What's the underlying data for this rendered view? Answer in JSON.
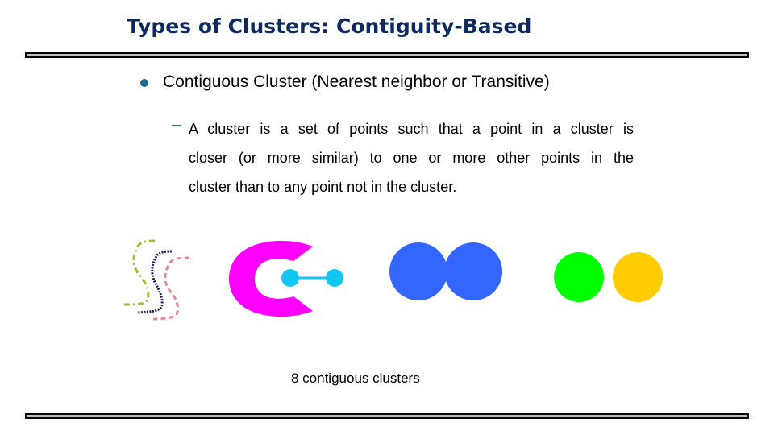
{
  "slide": {
    "title": "Types of Clusters: Contiguity-Based",
    "bullet": {
      "text": "Contiguous Cluster (Nearest neighbor or Transitive)",
      "sub_bullet": {
        "lines": [
          "A cluster is a set of points such that a point in a cluster is",
          "closer (or more similar) to one or more other points in the",
          "cluster than to any point not in the cluster."
        ]
      }
    },
    "figure": {
      "caption": "8 contiguous clusters",
      "clusters": [
        {
          "name": "green-dash-dot-s-curve",
          "shape": "s-curve",
          "style": "dash-dot",
          "color": "#9dc02c"
        },
        {
          "name": "navy-dotted-s-curve",
          "shape": "s-curve",
          "style": "dotted",
          "color": "#1b1f5e"
        },
        {
          "name": "pink-dashed-s-curve",
          "shape": "s-curve",
          "style": "dashed",
          "color": "#e08a9a"
        },
        {
          "name": "magenta-c-shape",
          "shape": "c-shape",
          "color": "#ff00ff"
        },
        {
          "name": "cyan-dumbbell",
          "shape": "two-points-with-link",
          "color": "#12c6f2"
        },
        {
          "name": "blue-touching-circles",
          "shape": "two-overlapping-circles",
          "color": "#3366ff"
        },
        {
          "name": "green-circle",
          "shape": "circle",
          "color": "#00ff00"
        },
        {
          "name": "yellow-circle",
          "shape": "circle",
          "color": "#ffcc00"
        }
      ]
    },
    "colors": {
      "title": "#0e2a5c",
      "bullet": "#1d6a8e",
      "dash": "#2a6f7f",
      "rule_fill": "#bdbdbd",
      "rule_border": "#000000"
    }
  }
}
